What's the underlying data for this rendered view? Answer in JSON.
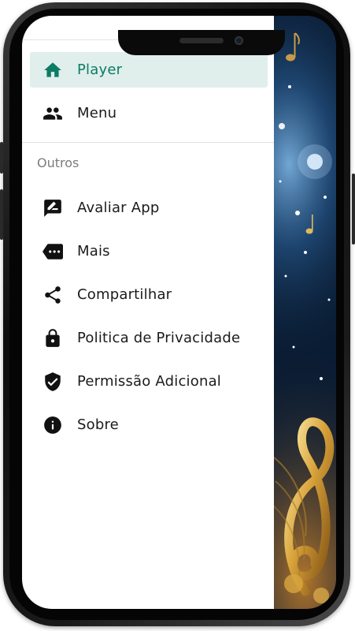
{
  "drawer": {
    "primary_items": [
      {
        "label": "Player",
        "icon": "home-icon",
        "active": true
      },
      {
        "label": "Menu",
        "icon": "people-icon",
        "active": false
      }
    ],
    "section_title": "Outros",
    "other_items": [
      {
        "label": "Avaliar App",
        "icon": "rate-review-icon"
      },
      {
        "label": "Mais",
        "icon": "more-label-icon"
      },
      {
        "label": "Compartilhar",
        "icon": "share-icon"
      },
      {
        "label": "Politica de Privacidade",
        "icon": "lock-icon"
      },
      {
        "label": "Permissão Adicional",
        "icon": "verified-shield-icon"
      },
      {
        "label": "Sobre",
        "icon": "info-icon"
      }
    ]
  },
  "colors": {
    "accent": "#0b7d63",
    "active_bg": "#e0eeec",
    "icon": "#111111",
    "section_text": "#7c7c7c"
  }
}
